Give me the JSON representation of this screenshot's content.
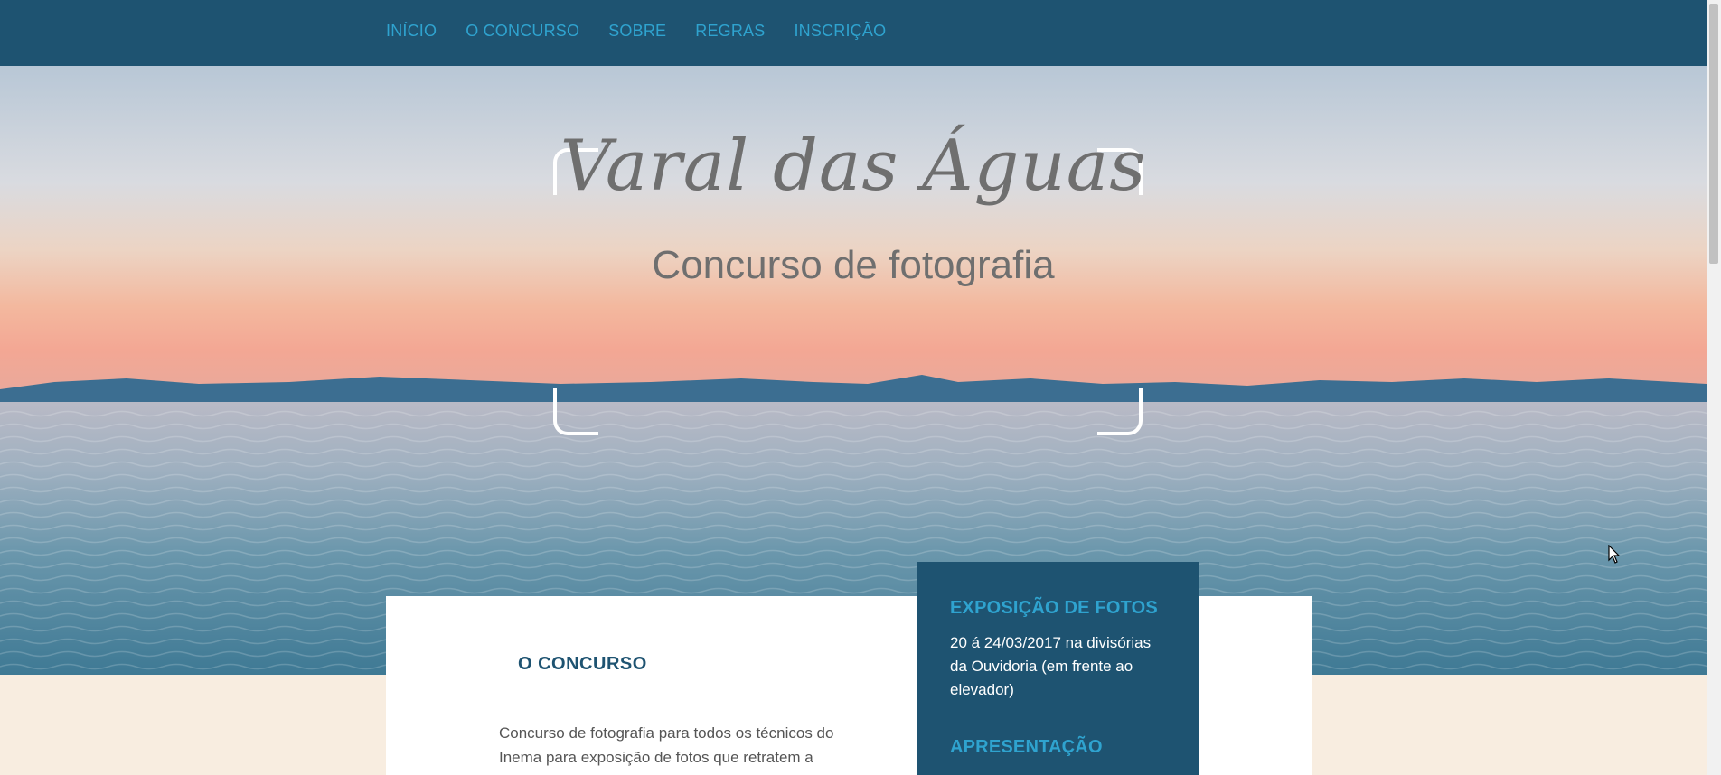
{
  "nav": {
    "items": [
      {
        "label": "INÍCIO"
      },
      {
        "label": "O CONCURSO"
      },
      {
        "label": "SOBRE"
      },
      {
        "label": "REGRAS"
      },
      {
        "label": "INSCRIÇÃO"
      }
    ]
  },
  "hero": {
    "title": "Varal das Águas",
    "subtitle": "Concurso de fotografia",
    "image": "lake-sunset-photo"
  },
  "contest": {
    "heading": "O CONCURSO",
    "text": "Concurso de fotografia para todos os técnicos do Inema para exposição de fotos que retratem a"
  },
  "sidebar": {
    "exhibition_heading": "EXPOSIÇÃO DE FOTOS",
    "exhibition_text": "20 á 24/03/2017 na divisórias da Ouvidoria (em frente ao elevador)",
    "presentation_heading": "APRESENTAÇÃO"
  },
  "colors": {
    "nav_bg": "#1e5371",
    "nav_link": "#2fa3cf",
    "page_bg": "#f8ede0"
  }
}
